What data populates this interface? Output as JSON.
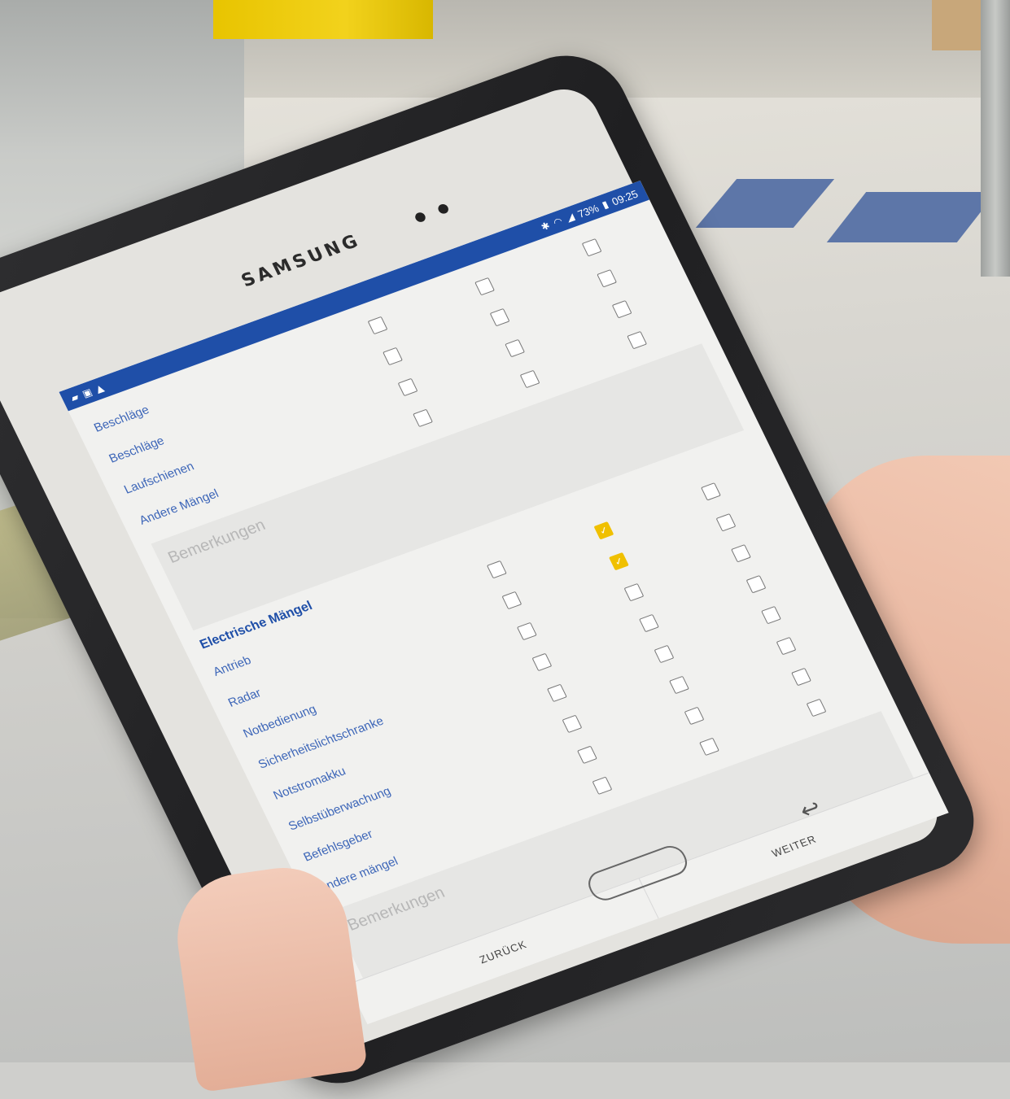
{
  "device": {
    "brand": "SAMSUNG"
  },
  "statusbar": {
    "battery": "73%",
    "time": "09:25"
  },
  "section_top": {
    "rows": [
      {
        "label": "Beschläge",
        "checks": [
          false,
          false,
          false
        ]
      },
      {
        "label": "Beschläge",
        "checks": [
          false,
          false,
          false
        ]
      },
      {
        "label": "Laufschienen",
        "checks": [
          false,
          false,
          false
        ]
      },
      {
        "label": "Andere Mängel",
        "checks": [
          false,
          false,
          false
        ]
      }
    ],
    "remarks_placeholder": "Bemerkungen"
  },
  "section_electric": {
    "title": "Electrische Mängel",
    "rows": [
      {
        "label": "Antrieb",
        "checks": [
          false,
          true,
          false
        ]
      },
      {
        "label": "Radar",
        "checks": [
          false,
          true,
          false
        ]
      },
      {
        "label": "Notbedienung",
        "checks": [
          false,
          false,
          false
        ]
      },
      {
        "label": "Sicherheitslichtschranke",
        "checks": [
          false,
          false,
          false
        ]
      },
      {
        "label": "Notstromakku",
        "checks": [
          false,
          false,
          false
        ]
      },
      {
        "label": "Selbstüberwachung",
        "checks": [
          false,
          false,
          false
        ]
      },
      {
        "label": "Befehlsgeber",
        "checks": [
          false,
          false,
          false
        ]
      },
      {
        "label": "Andere mängel",
        "checks": [
          false,
          false,
          false
        ]
      }
    ],
    "remarks_placeholder": "Bemerkungen"
  },
  "nav": {
    "back_label": "ZURÜCK",
    "next_label": "WEITER"
  },
  "colors": {
    "accent": "#1f4fa8",
    "checked": "#f0c000"
  }
}
